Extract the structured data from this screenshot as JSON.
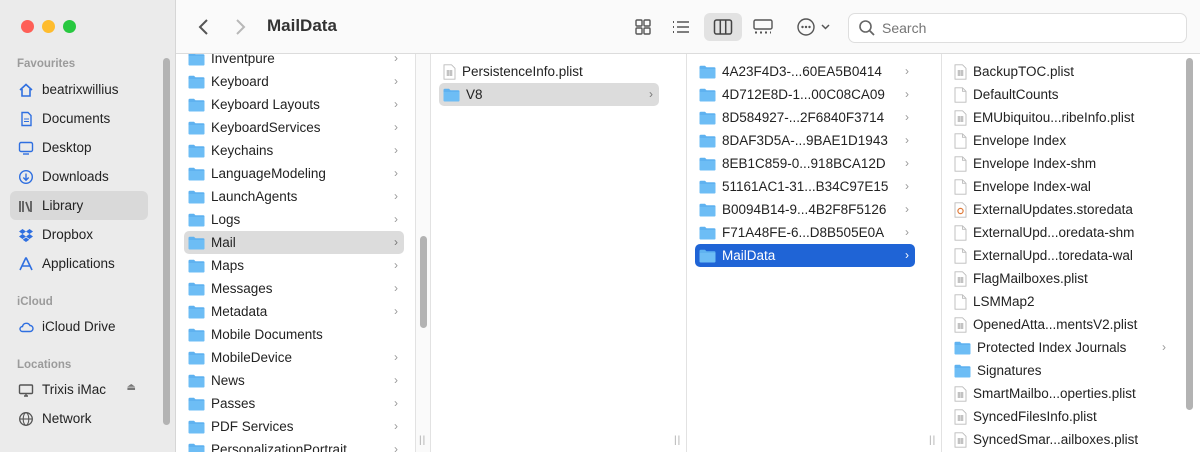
{
  "window": {
    "title": "MailData"
  },
  "toolbar": {
    "back_icon": "chevron-left-icon",
    "forward_icon": "chevron-right-icon",
    "search_placeholder": "Search"
  },
  "sidebar": {
    "favourites_header": "Favourites",
    "favourites": [
      {
        "label": "beatrixwillius",
        "icon": "home-icon"
      },
      {
        "label": "Documents",
        "icon": "document-icon"
      },
      {
        "label": "Desktop",
        "icon": "desktop-icon"
      },
      {
        "label": "Downloads",
        "icon": "download-icon"
      },
      {
        "label": "Library",
        "icon": "library-icon"
      },
      {
        "label": "Dropbox",
        "icon": "dropbox-icon"
      },
      {
        "label": "Applications",
        "icon": "applications-icon"
      }
    ],
    "icloud_header": "iCloud",
    "icloud": [
      {
        "label": "iCloud Drive",
        "icon": "cloud-icon"
      }
    ],
    "locations_header": "Locations",
    "locations": [
      {
        "label": "Trixis iMac",
        "icon": "computer-icon"
      },
      {
        "label": "Network",
        "icon": "network-icon"
      }
    ]
  },
  "columns": {
    "col1": [
      "Inventpure",
      "Keyboard",
      "Keyboard Layouts",
      "KeyboardServices",
      "Keychains",
      "LanguageModeling",
      "LaunchAgents",
      "Logs",
      "Mail",
      "Maps",
      "Messages",
      "Metadata",
      "Mobile Documents",
      "MobileDevice",
      "News",
      "Passes",
      "PDF Services",
      "PersonalizationPortrait"
    ],
    "col2": [
      "PersistenceInfo.plist",
      "V8"
    ],
    "col3": [
      "4A23F4D3-...60EA5B0414",
      "4D712E8D-1...00C08CA09",
      "8D584927-...2F6840F3714",
      "8DAF3D5A-...9BAE1D1943",
      "8EB1C859-0...918BCA12D",
      "51161AC1-31...B34C97E15",
      "B0094B14-9...4B2F8F5126",
      "F71A48FE-6...D8B505E0A",
      "MailData"
    ],
    "col4": [
      "BackupTOC.plist",
      "DefaultCounts",
      "EMUbiquitou...ribeInfo.plist",
      "Envelope Index",
      "Envelope Index-shm",
      "Envelope Index-wal",
      "ExternalUpdates.storedata",
      "ExternalUpd...oredata-shm",
      "ExternalUpd...toredata-wal",
      "FlagMailboxes.plist",
      "LSMMap2",
      "OpenedAtta...mentsV2.plist",
      "Protected Index Journals",
      "Signatures",
      "SmartMailbo...operties.plist",
      "SyncedFilesInfo.plist",
      "SyncedSmar...ailboxes.plist"
    ]
  },
  "colors": {
    "accent": "#1f64d6",
    "folder": "#5fb2f0",
    "sidebar_bg": "#ebebeb"
  }
}
